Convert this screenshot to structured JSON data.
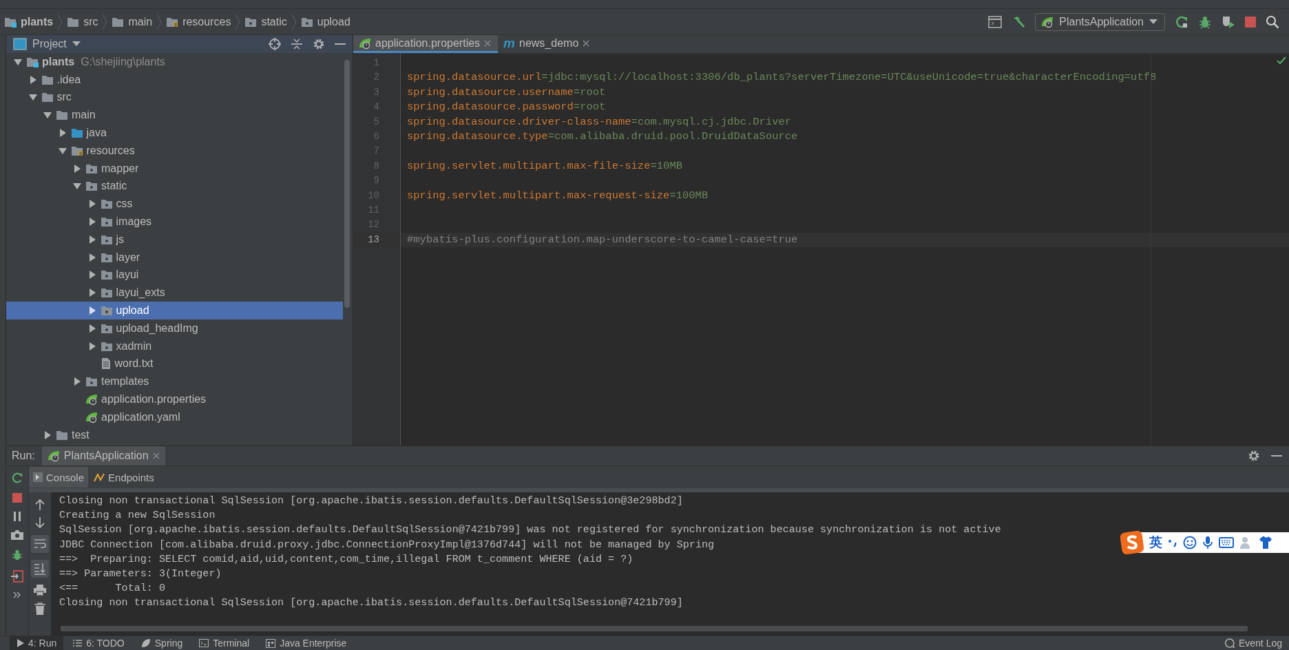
{
  "breadcrumb": [
    {
      "label": "plants",
      "kind": "module"
    },
    {
      "label": "src",
      "kind": "folder"
    },
    {
      "label": "main",
      "kind": "folder"
    },
    {
      "label": "resources",
      "kind": "resources"
    },
    {
      "label": "static",
      "kind": "res"
    },
    {
      "label": "upload",
      "kind": "res"
    }
  ],
  "toolbar": {
    "run_config": "PlantsApplication"
  },
  "project": {
    "title": "Project",
    "tree": [
      {
        "name": "plants",
        "hint": "G:\\shejiing\\plants",
        "kind": "module",
        "expanded": true,
        "selected": false,
        "children": [
          {
            "name": ".idea",
            "kind": "folder",
            "expanded": false,
            "selected": false
          },
          {
            "name": "src",
            "kind": "folder",
            "expanded": true,
            "selected": false,
            "children": [
              {
                "name": "main",
                "kind": "folder",
                "expanded": true,
                "selected": false,
                "children": [
                  {
                    "name": "java",
                    "kind": "source",
                    "expanded": false,
                    "selected": false
                  },
                  {
                    "name": "resources",
                    "kind": "resources",
                    "expanded": true,
                    "selected": false,
                    "children": [
                      {
                        "name": "mapper",
                        "kind": "res",
                        "expanded": false,
                        "selected": false
                      },
                      {
                        "name": "static",
                        "kind": "res",
                        "expanded": true,
                        "selected": false,
                        "children": [
                          {
                            "name": "css",
                            "kind": "res",
                            "expanded": false,
                            "selected": false
                          },
                          {
                            "name": "images",
                            "kind": "res",
                            "expanded": false,
                            "selected": false
                          },
                          {
                            "name": "js",
                            "kind": "res",
                            "expanded": false,
                            "selected": false
                          },
                          {
                            "name": "layer",
                            "kind": "res",
                            "expanded": false,
                            "selected": false
                          },
                          {
                            "name": "layui",
                            "kind": "res",
                            "expanded": false,
                            "selected": false
                          },
                          {
                            "name": "layui_exts",
                            "kind": "res",
                            "expanded": false,
                            "selected": false
                          },
                          {
                            "name": "upload",
                            "kind": "res",
                            "expanded": false,
                            "selected": true
                          },
                          {
                            "name": "upload_headImg",
                            "kind": "res",
                            "expanded": false,
                            "selected": false
                          },
                          {
                            "name": "xadmin",
                            "kind": "res",
                            "expanded": false,
                            "selected": false
                          },
                          {
                            "name": "word.txt",
                            "kind": "file",
                            "selected": false
                          }
                        ]
                      },
                      {
                        "name": "templates",
                        "kind": "res",
                        "expanded": false,
                        "selected": false
                      },
                      {
                        "name": "application.properties",
                        "kind": "spring",
                        "selected": false
                      },
                      {
                        "name": "application.yaml",
                        "kind": "spring",
                        "selected": false
                      }
                    ]
                  }
                ]
              },
              {
                "name": "test",
                "kind": "folder",
                "expanded": false,
                "selected": false
              }
            ]
          }
        ]
      }
    ]
  },
  "editor": {
    "tabs": [
      {
        "label": "application.properties",
        "kind": "spring",
        "selected": true
      },
      {
        "label": "news_demo",
        "kind": "letter",
        "icon_text": "m",
        "selected": false
      }
    ],
    "lines": [
      {
        "number": "1",
        "kind": "blank",
        "current": false
      },
      {
        "number": "2",
        "kind": "property",
        "key": "spring.datasource.url",
        "separator": "=",
        "value": "jdbc:mysql://localhost:3306/db_plants?serverTimezone=UTC&useUnicode=true&characterEncoding=utf8",
        "current": false
      },
      {
        "number": "3",
        "kind": "property",
        "key": "spring.datasource.username",
        "separator": "=",
        "value": "root",
        "current": false
      },
      {
        "number": "4",
        "kind": "property",
        "key": "spring.datasource.password",
        "separator": "=",
        "value": "root",
        "current": false
      },
      {
        "number": "5",
        "kind": "property",
        "key": "spring.datasource.driver-class-name",
        "separator": "=",
        "value": "com.mysql.cj.jdbc.Driver",
        "current": false
      },
      {
        "number": "6",
        "kind": "property",
        "key": "spring.datasource.type",
        "separator": "=",
        "value": "com.alibaba.druid.pool.DruidDataSource",
        "current": false
      },
      {
        "number": "7",
        "kind": "blank",
        "current": false
      },
      {
        "number": "8",
        "kind": "property",
        "key": "spring.servlet.multipart.max-file-size",
        "separator": "=",
        "value": "10MB",
        "current": false
      },
      {
        "number": "9",
        "kind": "blank",
        "current": false
      },
      {
        "number": "10",
        "kind": "property",
        "key": "spring.servlet.multipart.max-request-size",
        "separator": "=",
        "value": "100MB",
        "current": false
      },
      {
        "number": "11",
        "kind": "blank",
        "current": false
      },
      {
        "number": "12",
        "kind": "blank",
        "current": false
      },
      {
        "number": "13",
        "kind": "comment",
        "text": "#mybatis-plus.configuration.map-underscore-to-camel-case=true",
        "current": true
      }
    ]
  },
  "run": {
    "label": "Run:",
    "tab": "PlantsApplication",
    "subtabs": [
      {
        "label": "Console",
        "kind": "console",
        "selected": true
      },
      {
        "label": "Endpoints",
        "kind": "endpoints",
        "selected": false
      }
    ],
    "console": [
      "Closing non transactional SqlSession [org.apache.ibatis.session.defaults.DefaultSqlSession@3e298bd2]",
      "Creating a new SqlSession",
      "SqlSession [org.apache.ibatis.session.defaults.DefaultSqlSession@7421b799] was not registered for synchronization because synchronization is not active",
      "JDBC Connection [com.alibaba.druid.proxy.jdbc.ConnectionProxyImpl@1376d744] will not be managed by Spring",
      "==>  Preparing: SELECT comid,aid,uid,content,com_time,illegal FROM t_comment WHERE (aid = ?)",
      "==> Parameters: 3(Integer)",
      "<==      Total: 0",
      "Closing non transactional SqlSession [org.apache.ibatis.session.defaults.DefaultSqlSession@7421b799]"
    ]
  },
  "ime_bar": {
    "mode": "英"
  },
  "status_bar": {
    "items": [
      {
        "label": "4: Run",
        "kind": "run",
        "selected": true
      },
      {
        "label": "6: TODO",
        "kind": "todo",
        "selected": false
      },
      {
        "label": "Spring",
        "kind": "spring",
        "selected": false
      },
      {
        "label": "Terminal",
        "kind": "terminal",
        "selected": false
      },
      {
        "label": "Java Enterprise",
        "kind": "enterprise",
        "selected": false
      }
    ],
    "right": "Event Log"
  }
}
